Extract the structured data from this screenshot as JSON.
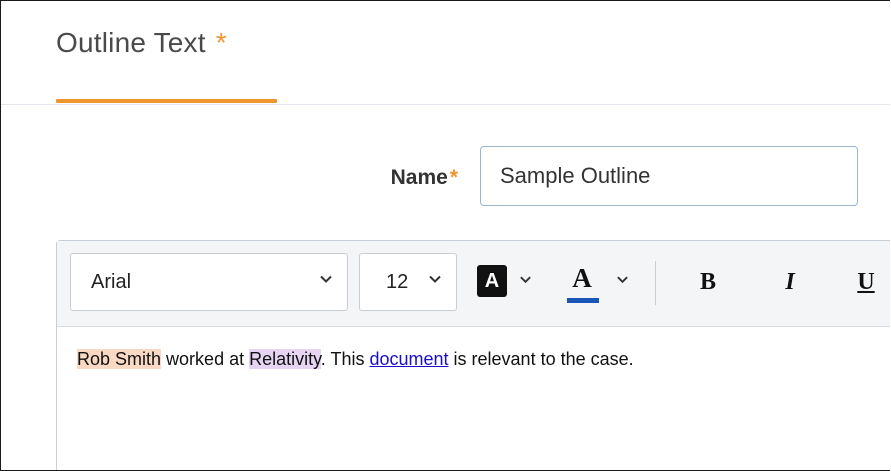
{
  "tab": {
    "title": "Outline Text",
    "required_marker": "*",
    "accent_color": "#f0962e"
  },
  "name_field": {
    "label": "Name",
    "required_marker": "*",
    "value": "Sample Outline"
  },
  "toolbar": {
    "font_family": "Arial",
    "font_size": "12",
    "highlight_icon_letter": "A",
    "font_color_letter": "A",
    "font_color_bar": "#1a56b8",
    "bold_label": "B",
    "italic_label": "I",
    "underline_label": "U"
  },
  "content": {
    "segment1_highlighted": "Rob Smith",
    "segment1_highlight_color": "#f9d9c3",
    "segment2": " worked at ",
    "segment3_highlighted": "Relativity",
    "segment3_highlight_color": "#e6d4f2",
    "segment4": ". This ",
    "link_text": "document",
    "segment5": " is relevant to the case."
  }
}
